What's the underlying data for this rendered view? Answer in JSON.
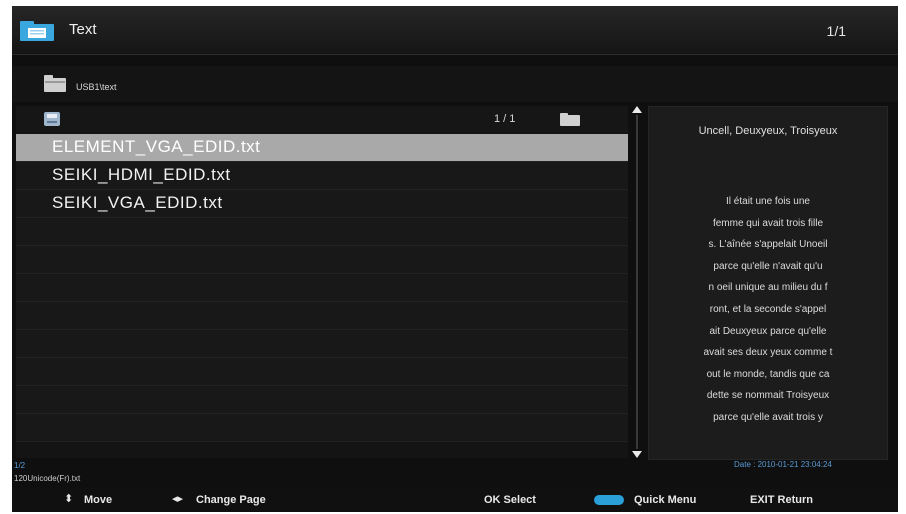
{
  "header": {
    "title": "Text",
    "page": "1/1"
  },
  "path": {
    "text": "USB1\\text"
  },
  "list": {
    "count": "1 / 1",
    "items": [
      {
        "name": "ELEMENT_VGA_EDID.txt",
        "selected": true
      },
      {
        "name": "SEIKI_HDMI_EDID.txt",
        "selected": false
      },
      {
        "name": "SEIKI_VGA_EDID.txt",
        "selected": false
      }
    ]
  },
  "preview": {
    "title": "Uncell, Deuxyeux, Troisyeux",
    "lines": [
      "Il était une fois une",
      "femme qui avait trois fille",
      "s. L'aînée s'appelait Unoeil",
      "parce qu'elle n'avait qu'u",
      "n oeil unique au milieu du f",
      "ront, et la seconde s'appel",
      "ait Deuxyeux parce qu'elle",
      "avait ses deux yeux comme t",
      "out le monde, tandis que ca",
      "dette se nommait Troisyeux",
      "parce qu'elle avait trois y"
    ]
  },
  "info": {
    "index": "1/2",
    "file": "120Unicode(Fr).txt",
    "date": "Date : 2010-01-21 23:04:24"
  },
  "footer": {
    "move": "Move",
    "change_page": "Change Page",
    "select": "OK Select",
    "quick_menu": "Quick Menu",
    "exit": "EXIT Return",
    "move_glyph": "⬍",
    "page_glyph": "◂▸"
  },
  "colors": {
    "accent": "#2a9fd8",
    "selection": "#a9a9a9",
    "info_text": "#5b9bd5"
  },
  "icons": {
    "header": "text-folder-icon",
    "path": "folder-icon",
    "list_header": "drive-icon",
    "list_folder": "folder-icon"
  }
}
